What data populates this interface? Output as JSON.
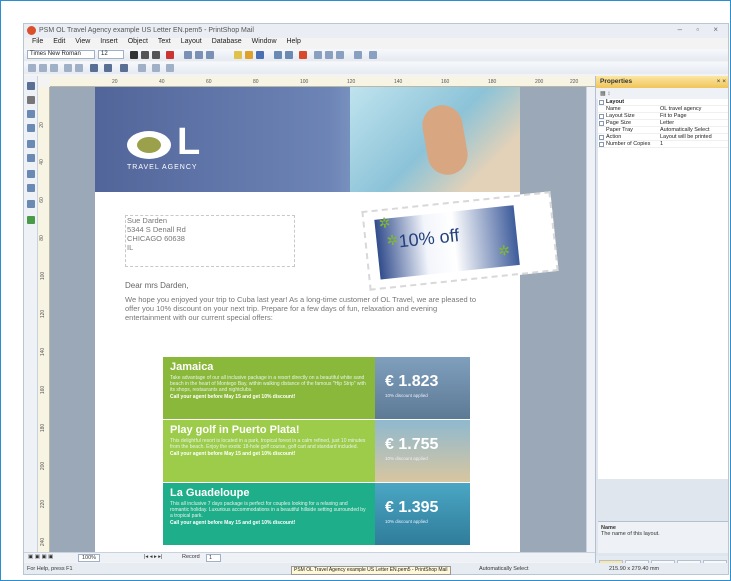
{
  "window_title": "PSM OL Travel Agency example US Letter EN.pem5 - PrintShop Mail",
  "menu": [
    "File",
    "Edit",
    "View",
    "Insert",
    "Object",
    "Text",
    "Layout",
    "Database",
    "Window",
    "Help"
  ],
  "toolbar": {
    "font": "Times New Roman",
    "size": "12"
  },
  "ruler_marks": [
    "20",
    "40",
    "60",
    "80",
    "100",
    "120",
    "140",
    "160",
    "180",
    "200",
    "220"
  ],
  "vruler_marks": [
    "20",
    "40",
    "60",
    "80",
    "100",
    "120",
    "140",
    "160",
    "180",
    "200",
    "220",
    "240"
  ],
  "doc": {
    "logo_letter": "L",
    "agency": "TRAVEL AGENCY",
    "address": [
      "Sue Darden",
      "5344 S Denall Rd",
      "CHICAGO 60638",
      "IL"
    ],
    "stamp": "10% off",
    "greeting": "Dear mrs Darden,",
    "body": "We hope you enjoyed your trip to Cuba last year! As a long-time customer of OL Travel, we are pleased to offer you 10% discount on your next trip. Prepare for a few days of fun, relaxation and evening entertainment with our current special offers:",
    "offers": [
      {
        "title": "Jamaica",
        "desc": "Take advantage of our all inclusive package in a resort directly on a beautiful white sand beach in the heart of Montego Bay, within walking distance of the famous \"Hip Strip\" with its shops, restaurants and nightclubs.",
        "cta": "Call your agent before May 15 and get 10% discount!",
        "price": "€ 1.823",
        "note": "10% discount applied",
        "color": "#8ab83a",
        "img": "#6f8fae"
      },
      {
        "title": "Play golf in Puerto Plata!",
        "desc": "This delightful resort is located in a park, tropical forest in a calm refined, just 10 minutes from the beach. Enjoy the exotic 18-hole golf course, golf cart and standard included.",
        "cta": "Call your agent before May 15 and get 10% discount!",
        "price": "€ 1.755",
        "note": "10% discount applied",
        "color": "#9ccc4a",
        "img": "#c8b48e"
      },
      {
        "title": "La Guadeloupe",
        "desc": "This all inclusive 7 days package is perfect for couples looking for a relaxing and romantic holiday. Luxurious accommodations in a beautiful hillside setting surrounded by a tropical park.",
        "cta": "Call your agent before May 15 and get 10% discount!",
        "price": "€ 1.395",
        "note": "10% discount applied",
        "color": "#1fae8a",
        "img": "#3c8fae"
      }
    ]
  },
  "properties": {
    "title": "Properties",
    "group": "Layout",
    "rows": [
      [
        "Name",
        "OL travel agency"
      ],
      [
        "Layout Size",
        "Fit to Page"
      ],
      [
        "Page Size",
        "Letter"
      ],
      [
        "Paper Tray",
        "Automatically Select"
      ],
      [
        "Action",
        "Layout will be printed"
      ],
      [
        "Number of Copies",
        "1"
      ]
    ],
    "desc_title": "Name",
    "desc_text": "The name of this layout."
  },
  "tabs": [
    "P...",
    "ab T...",
    "A W...",
    "[...",
    "S..."
  ],
  "statusbar": {
    "zoom": "100%",
    "record_label": "Record",
    "record": "1",
    "help": "For Help, press F1",
    "tray": "Automatically Select",
    "size": "215.90 x 279.40 mm"
  },
  "taskbar_text": "PSM OL Travel Agency example US Letter EN.pem5 - PrintShop Mail"
}
